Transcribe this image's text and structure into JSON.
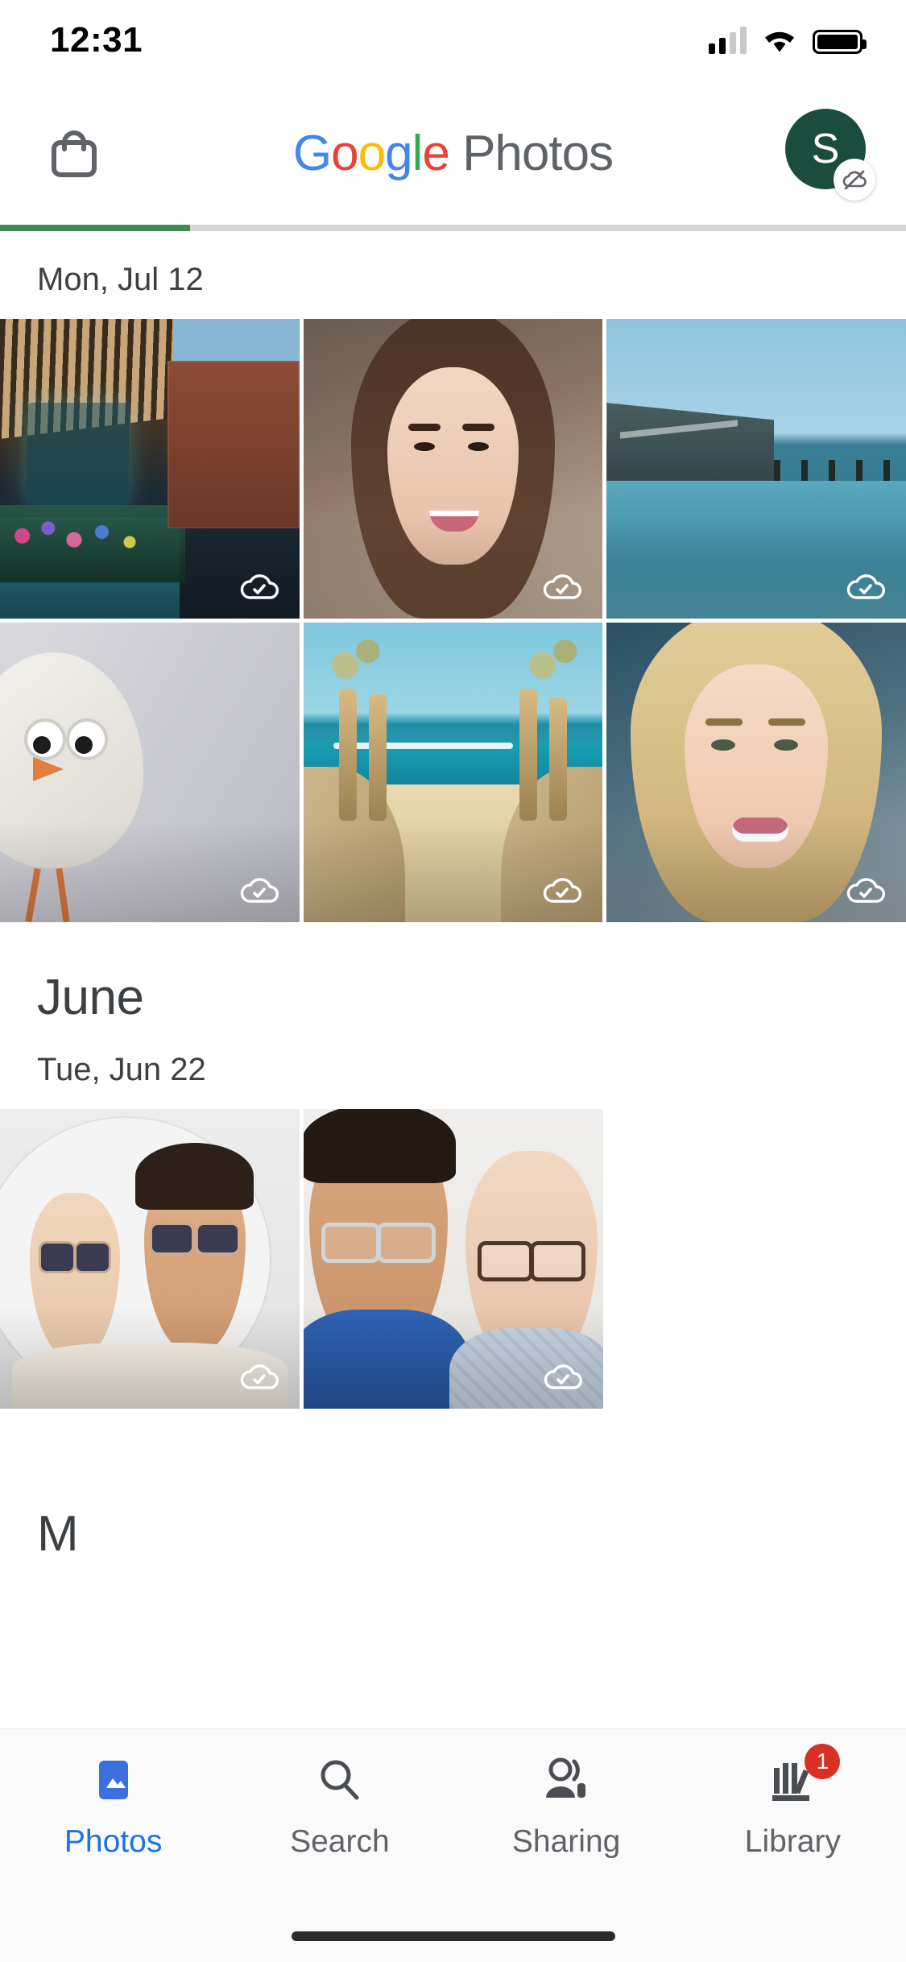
{
  "status_bar": {
    "time": "12:31",
    "cellular_icon": "cellular-signal-icon",
    "cellular_bars_filled": 2,
    "cellular_bars_total": 4,
    "wifi_icon": "wifi-icon",
    "battery_icon": "battery-full-icon"
  },
  "header": {
    "store_icon": "shopping-bag-icon",
    "logo": {
      "google": [
        "G",
        "o",
        "o",
        "g",
        "l",
        "e"
      ],
      "product": "Photos"
    },
    "account": {
      "initial": "S",
      "avatar_color": "#1B4D3E",
      "badge_icon": "cloud-off-icon"
    }
  },
  "backup_progress": {
    "percent": 21,
    "fill_color": "#3F8A55",
    "track_color": "#D6D6D6"
  },
  "sections": [
    {
      "month_label": "",
      "date_label": "Mon, Jul 12",
      "rows": [
        {
          "photos": [
            {
              "caption": "wild at heart flower shop street",
              "art": "art-shop",
              "badge": "cloud-done-icon"
            },
            {
              "caption": "smiling woman portrait",
              "art": "art-portrait-a",
              "badge": "cloud-done-icon"
            },
            {
              "caption": "infinity pool modern building",
              "art": "art-pool",
              "badge": "cloud-done-icon"
            }
          ]
        },
        {
          "photos": [
            {
              "caption": "cartoon egg bird character",
              "art": "art-egg",
              "badge": "cloud-done-icon"
            },
            {
              "caption": "beach path between dunes",
              "art": "art-beach",
              "badge": "cloud-done-icon"
            },
            {
              "caption": "blonde woman portrait",
              "art": "art-portrait-b",
              "badge": "cloud-done-icon"
            }
          ]
        }
      ]
    },
    {
      "month_label": "June",
      "date_label": "Tue, Jun 22",
      "rows": [
        {
          "photos": [
            {
              "caption": "couple wearing sunglasses",
              "art": "art-sun",
              "badge": "cloud-done-icon"
            },
            {
              "caption": "couple wearing eyeglasses",
              "art": "art-eye",
              "badge": "cloud-done-icon"
            }
          ]
        }
      ]
    }
  ],
  "next_section_partial": {
    "month_label": "M"
  },
  "bottom_nav": {
    "active_index": 0,
    "active_color": "#1A73E8",
    "inactive_color": "#5F6368",
    "items": [
      {
        "label": "Photos",
        "icon": "photos-icon",
        "badge": ""
      },
      {
        "label": "Search",
        "icon": "search-icon",
        "badge": ""
      },
      {
        "label": "Sharing",
        "icon": "sharing-icon",
        "badge": ""
      },
      {
        "label": "Library",
        "icon": "library-icon",
        "badge": "1"
      }
    ],
    "badge_color": "#D93025"
  },
  "home_indicator": "home-indicator"
}
